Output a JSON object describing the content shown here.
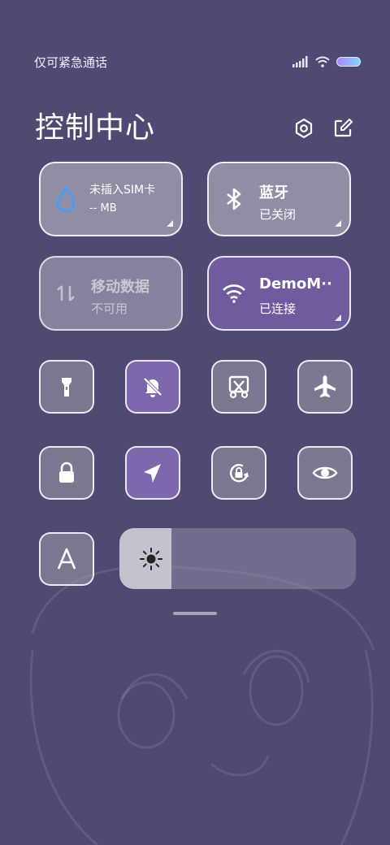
{
  "status_bar": {
    "carrier": "仅可紧急通话"
  },
  "title": "控制中心",
  "tiles": {
    "data_usage": {
      "line1": "未插入SIM卡",
      "line2": "-- MB"
    },
    "bluetooth": {
      "label": "蓝牙",
      "status": "已关闭"
    },
    "mobile_data": {
      "label": "移动数据",
      "status": "不可用"
    },
    "wifi": {
      "label": "DemoM··",
      "status": "已连接"
    }
  },
  "toggles": [
    {
      "icon": "flashlight-icon",
      "active": false
    },
    {
      "icon": "mute-bell-icon",
      "active": true
    },
    {
      "icon": "screenshot-icon",
      "active": false
    },
    {
      "icon": "airplane-icon",
      "active": false
    },
    {
      "icon": "lock-icon",
      "active": false
    },
    {
      "icon": "location-icon",
      "active": true
    },
    {
      "icon": "rotation-lock-icon",
      "active": false
    },
    {
      "icon": "eye-icon",
      "active": false
    }
  ],
  "auto_brightness_icon": "font-a-icon",
  "brightness": {
    "level": 0.22
  },
  "colors": {
    "background": "#4f4a72",
    "active": "#7d68ad",
    "wifi_active": "#6f5b9e",
    "water": "#3aa0ff"
  }
}
